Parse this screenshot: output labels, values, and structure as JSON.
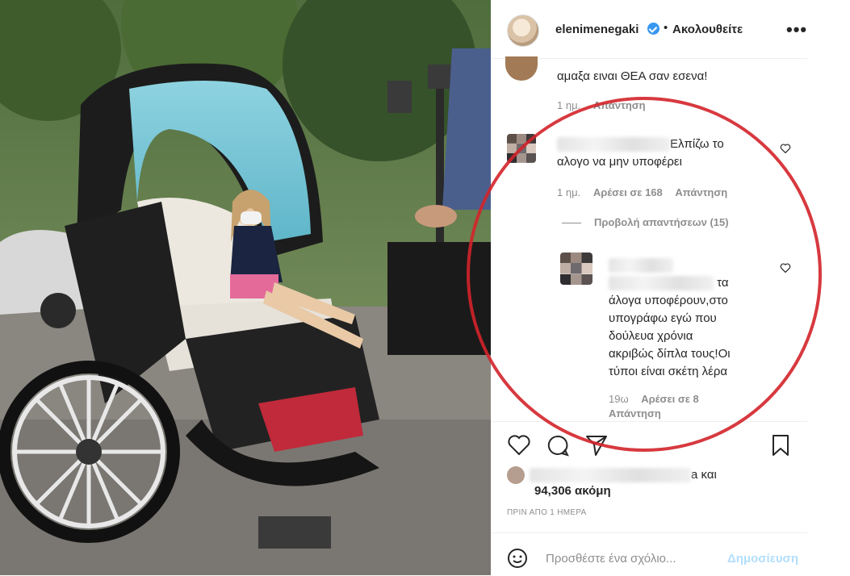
{
  "header": {
    "username": "elenimenegaki",
    "separator": "•",
    "follow_label": "Ακολουθείτε",
    "more_label": "•••"
  },
  "comments": [
    {
      "text": "αμαξα ειναι ΘΕΑ σαν εσενα!",
      "time": "1 ημ.",
      "reply": "Απάντηση"
    },
    {
      "text_line1": "Ελπίζω το",
      "text_line2": "αλογο να μην υποφέρει",
      "time": "1 ημ.",
      "likes": "Αρέσει σε 168",
      "reply": "Απάντηση",
      "view_replies": "Προβολή απαντήσεων (15)"
    },
    {
      "line1": "τα",
      "line2": "άλογα υποφέρουν,στο",
      "line3": "υπογράφω εγώ που",
      "line4": "δούλευα χρόνια",
      "line5": "ακριβώς δίπλα τους!Οι",
      "line6": "τύποι είναι σκέτη λέρα",
      "time": "19ω",
      "likes": "Αρέσει σε 8",
      "reply": "Απάντηση"
    }
  ],
  "likes": {
    "connector": "a και",
    "count": "94,306 ακόμη"
  },
  "posted_ago": "ΠΡΙΝ ΑΠΟ 1 ΗΜΕΡΑ",
  "add_comment": {
    "placeholder": "Προσθέστε ένα σχόλιο...",
    "post_label": "Δημοσίευση"
  },
  "colors": {
    "accent_blue": "#3897f0",
    "annotation_red": "#d3232a",
    "muted_text": "#8e8e8e"
  }
}
